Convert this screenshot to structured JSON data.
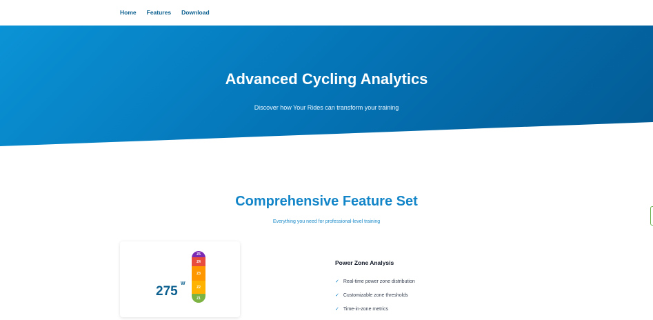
{
  "nav": {
    "links": [
      "Home",
      "Features",
      "Download"
    ]
  },
  "hero": {
    "title": "Advanced Cycling Analytics",
    "subtitle": "Discover how Your Rides can transform your training"
  },
  "features_section": {
    "title": "Comprehensive Feature Set",
    "subtitle": "Everything you need for professional-level training"
  },
  "power_card": {
    "watts": "275",
    "unit": "W",
    "zones": [
      {
        "label": "Z5",
        "color": "#7b2ab3"
      },
      {
        "label": "Z4",
        "color": "#e74c3c"
      },
      {
        "label": "Z3",
        "color": "#ff9800"
      },
      {
        "label": "Z2",
        "color": "#ffb300"
      },
      {
        "label": "Z1",
        "color": "#7cb342"
      }
    ]
  },
  "feature": {
    "title": "Power Zone Analysis",
    "check_icon": "✓",
    "items": [
      "Real-time power zone distribution",
      "Customizable zone thresholds",
      "Time-in-zone metrics"
    ]
  },
  "colors": {
    "hero_start": "#0a93d6",
    "hero_end": "#035a93",
    "accent": "#1285c8",
    "nav_link": "#0b5f8f"
  }
}
